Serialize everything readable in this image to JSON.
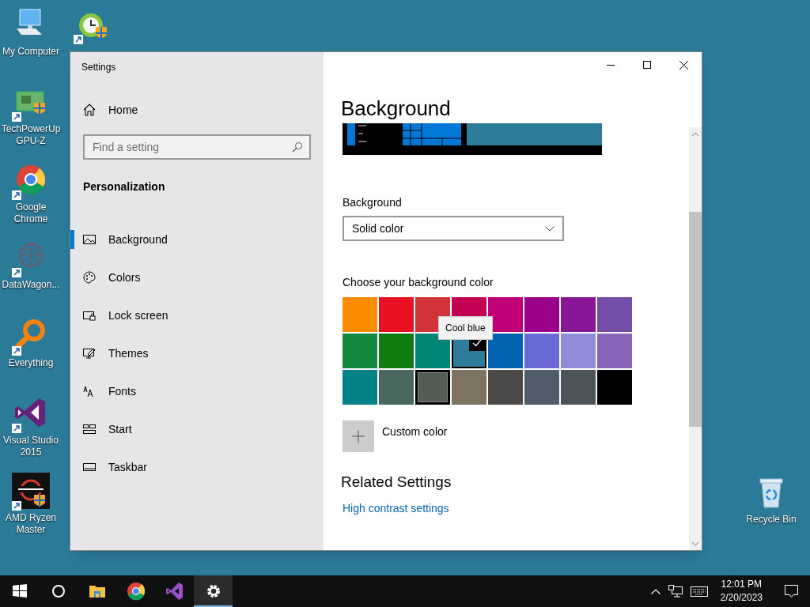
{
  "desktop_icons": [
    {
      "kind": "computer",
      "label": "My Computer"
    },
    {
      "kind": "clock"
    },
    {
      "kind": "gpu",
      "label": "TechPowerUp GPU-Z"
    },
    {
      "kind": "chrome",
      "label": "Google Chrome"
    },
    {
      "kind": "network",
      "label": "DataWagon..."
    },
    {
      "kind": "search",
      "label": "Everything"
    },
    {
      "kind": "vs",
      "label": "Visual Studio 2015"
    },
    {
      "kind": "ryzen",
      "label": "AMD Ryzen Master"
    },
    {
      "kind": "recycle",
      "label": "Recycle Bin"
    }
  ],
  "window": {
    "title": "Settings",
    "sidebar": {
      "home": "Home",
      "search": {
        "placeholder": "Find a setting"
      },
      "section": "Personalization",
      "items": [
        {
          "kind": "background",
          "label": "Background",
          "selected": true
        },
        {
          "kind": "colors",
          "label": "Colors",
          "selected": false
        },
        {
          "kind": "lock",
          "label": "Lock screen",
          "selected": false
        },
        {
          "kind": "themes",
          "label": "Themes",
          "selected": false
        },
        {
          "kind": "fonts",
          "label": "Fonts",
          "selected": false
        },
        {
          "kind": "start",
          "label": "Start",
          "selected": false
        },
        {
          "kind": "taskbar",
          "label": "Taskbar",
          "selected": false
        }
      ]
    },
    "content": {
      "heading": "Background",
      "background_label": "Background",
      "background_dropdown": "Solid color",
      "colors_label": "Choose your background color",
      "swatches": [
        {
          "color": "#ff8c00",
          "selected": false,
          "hovered": false
        },
        {
          "color": "#e81123",
          "selected": false,
          "hovered": false
        },
        {
          "color": "#d13438",
          "selected": false,
          "hovered": false
        },
        {
          "color": "#c30052",
          "selected": false,
          "hovered": false
        },
        {
          "color": "#bf0077",
          "selected": false,
          "hovered": false
        },
        {
          "color": "#9a0089",
          "selected": false,
          "hovered": false
        },
        {
          "color": "#881798",
          "selected": false,
          "hovered": false
        },
        {
          "color": "#744da9",
          "selected": false,
          "hovered": false
        },
        {
          "color": "#10893e",
          "selected": false,
          "hovered": false
        },
        {
          "color": "#107c10",
          "selected": false,
          "hovered": false
        },
        {
          "color": "#018574",
          "selected": false,
          "hovered": false
        },
        {
          "color": "#2d7d9a",
          "selected": true,
          "hovered": false
        },
        {
          "color": "#0063b1",
          "selected": false,
          "hovered": false
        },
        {
          "color": "#6b69d6",
          "selected": false,
          "hovered": false
        },
        {
          "color": "#8e8cd8",
          "selected": false,
          "hovered": false
        },
        {
          "color": "#8764b8",
          "selected": false,
          "hovered": false
        },
        {
          "color": "#038387",
          "selected": false,
          "hovered": false
        },
        {
          "color": "#486860",
          "selected": false,
          "hovered": false
        },
        {
          "color": "#525e54",
          "selected": false,
          "hovered": true
        },
        {
          "color": "#7e735f",
          "selected": false,
          "hovered": false
        },
        {
          "color": "#4c4a48",
          "selected": false,
          "hovered": false
        },
        {
          "color": "#515c6b",
          "selected": false,
          "hovered": false
        },
        {
          "color": "#4a5459",
          "selected": false,
          "hovered": false
        },
        {
          "color": "#000000",
          "selected": false,
          "hovered": false
        }
      ],
      "tooltip": "Cool blue",
      "custom_color": "Custom color",
      "related_heading": "Related Settings",
      "related_link": "High contrast settings"
    }
  },
  "taskbar": {
    "apps": [
      {
        "kind": "start",
        "selected": false
      },
      {
        "kind": "cortana",
        "selected": false
      },
      {
        "kind": "explorer",
        "selected": false
      },
      {
        "kind": "chrome",
        "selected": false
      },
      {
        "kind": "vs",
        "selected": false
      },
      {
        "kind": "settings",
        "selected": true
      }
    ],
    "time": "12:01 PM",
    "date": "2/20/2023"
  }
}
